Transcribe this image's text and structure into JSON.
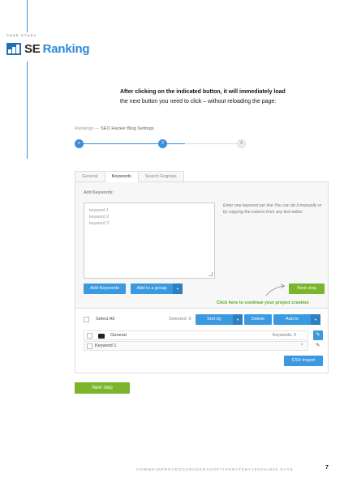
{
  "header": {
    "case_study": "CASE STUDY",
    "logo_se": "SE",
    "logo_ranking": "Ranking"
  },
  "intro": {
    "line1": "After clicking on the indicated button, it will immediately load",
    "line2": "the next button you need to click – without reloading the page:"
  },
  "screenshot": {
    "breadcrumb_root": "Rankings —",
    "breadcrumb_page": "SEO Hacker Blog Settings",
    "steps": {
      "step1": "✔",
      "step2": "2",
      "step3": "3",
      "progress_percent": 65
    },
    "tabs": [
      "General",
      "Keywords",
      "Search Engines"
    ],
    "add_keywords_label": "Add Keywords:",
    "keywords": [
      "keyword 1",
      "keyword 2",
      "keyword 3"
    ],
    "hint": "Enter one keyword per line.You can do it manually or by copying the column from any text editor.",
    "add_keywords_button": "Add Keywords",
    "add_to_group_button": "Add to a group",
    "next_step_button": "Next step",
    "green_note": "Click here to continue your project creation",
    "select_all": "Select All",
    "selected_label": "Selected:",
    "selected_count": "0",
    "sort_by": "Sort by",
    "delete": "Delete",
    "add_to": "Add to",
    "group_name": "General",
    "keywords_label": "Keywords:",
    "keywords_count": "0",
    "keyword_row": "Keyword 1",
    "csv_import": "CSV import",
    "caret": "▾",
    "close": "×",
    "edit": "✎"
  },
  "next_step_bottom": "Next step",
  "footer": {
    "text": "HOWWEIMPROVEDOURUSERADOPTIONRATEBY1650%IN60 DAYS",
    "page": "7"
  },
  "colors": {
    "blue": "#3b99e0",
    "green": "#7ab52c",
    "logo_blue": "#1f6fb8"
  }
}
